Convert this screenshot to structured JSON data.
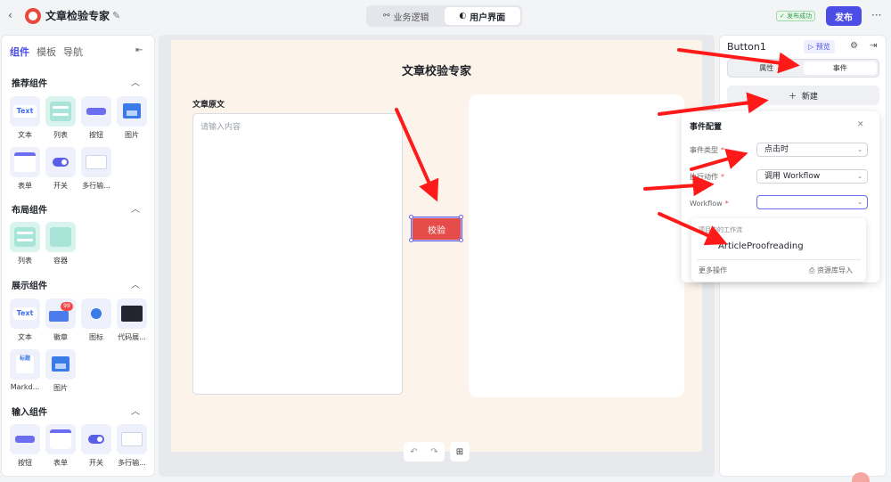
{
  "app": {
    "title": "文章检验专家",
    "publish_status": "发布成功",
    "publish_label": "发布"
  },
  "mode_tabs": [
    {
      "label": "业务逻辑"
    },
    {
      "label": "用户界面"
    }
  ],
  "left_panel": {
    "tabs": [
      "组件",
      "模板",
      "导航"
    ],
    "sections": [
      {
        "title": "推荐组件",
        "items": [
          "文本",
          "列表",
          "按钮",
          "图片",
          "表单",
          "开关",
          "多行输..."
        ]
      },
      {
        "title": "布局组件",
        "items": [
          "列表",
          "容器"
        ]
      },
      {
        "title": "展示组件",
        "items": [
          "文本",
          "徽章",
          "图标",
          "代码展...",
          "Markd...",
          "图片"
        ]
      },
      {
        "title": "输入组件",
        "items": [
          "按钮",
          "表单",
          "开关",
          "多行输..."
        ]
      }
    ],
    "tile_text": {
      "text": "Text",
      "badge": "99",
      "markdown": "标题"
    }
  },
  "canvas": {
    "title": "文章校验专家",
    "source_label": "文章原文",
    "source_placeholder": "请输入内容",
    "check_button": "校验"
  },
  "right_panel": {
    "component_name": "Button1",
    "preview_label": "预览",
    "tabs": [
      "属性",
      "事件"
    ],
    "new_label": "新建"
  },
  "event_config": {
    "title": "事件配置",
    "event_type_label": "事件类型",
    "event_type_value": "点击时",
    "action_label": "执行动作",
    "action_value": "调用 Workflow",
    "workflow_label": "Workflow",
    "workflow_value": "",
    "dropdown": {
      "group_label": "项目中的工作流",
      "item": "ArticleProofreading",
      "more_label": "更多操作",
      "import_label": "资源库导入"
    }
  },
  "colors": {
    "accent": "#4c4de6",
    "button_red": "#e54c4a",
    "arrow_red": "#ff1a1a",
    "canvas_bg": "#fcf3ea"
  }
}
